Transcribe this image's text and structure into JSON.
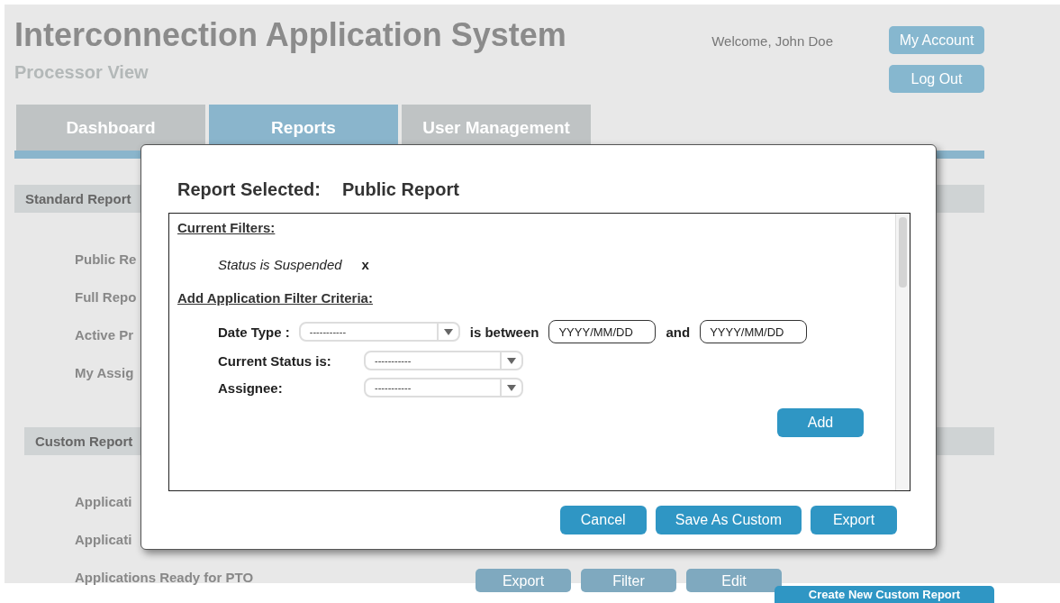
{
  "header": {
    "title": "Interconnection Application System",
    "subtitle": "Processor View",
    "welcome": "Welcome, John Doe",
    "buttons": [
      "My Account",
      "Log Out"
    ]
  },
  "tabs": [
    {
      "label": "Dashboard",
      "selected": false
    },
    {
      "label": "Reports",
      "selected": true
    },
    {
      "label": "User Management",
      "selected": false
    }
  ],
  "sections": [
    {
      "title": "Standard Report",
      "items": [
        {
          "label": "Public Re"
        },
        {
          "label": "Full Repo"
        },
        {
          "label": "Active Pr"
        },
        {
          "label": "My Assig"
        }
      ]
    },
    {
      "title": "Custom Report",
      "items": [
        {
          "label": "Applicati"
        },
        {
          "label": "Applicati"
        },
        {
          "label": "Applications Ready for PTO",
          "actions": [
            "Export",
            "Filter",
            "Edit"
          ]
        }
      ]
    }
  ],
  "create_button": "Create New Custom Report",
  "modal": {
    "title_label": "Report Selected:",
    "title_value": "Public Report",
    "current_filters_heading": "Current Filters:",
    "filters": [
      {
        "text": "Status is Suspended",
        "remove": "x"
      }
    ],
    "criteria_heading": "Add Application Filter Criteria:",
    "date_type": {
      "label": "Date Type :",
      "value": "-----------",
      "between": "is between",
      "from_placeholder": "YYYY/MM/DD",
      "and": "and",
      "to_placeholder": "YYYY/MM/DD"
    },
    "selects": [
      {
        "label": "Current Status is:",
        "value": "-----------"
      },
      {
        "label": "Assignee:",
        "value": "-----------"
      }
    ],
    "add_button": "Add",
    "buttons": [
      "Cancel",
      "Save As Custom",
      "Export"
    ]
  }
}
